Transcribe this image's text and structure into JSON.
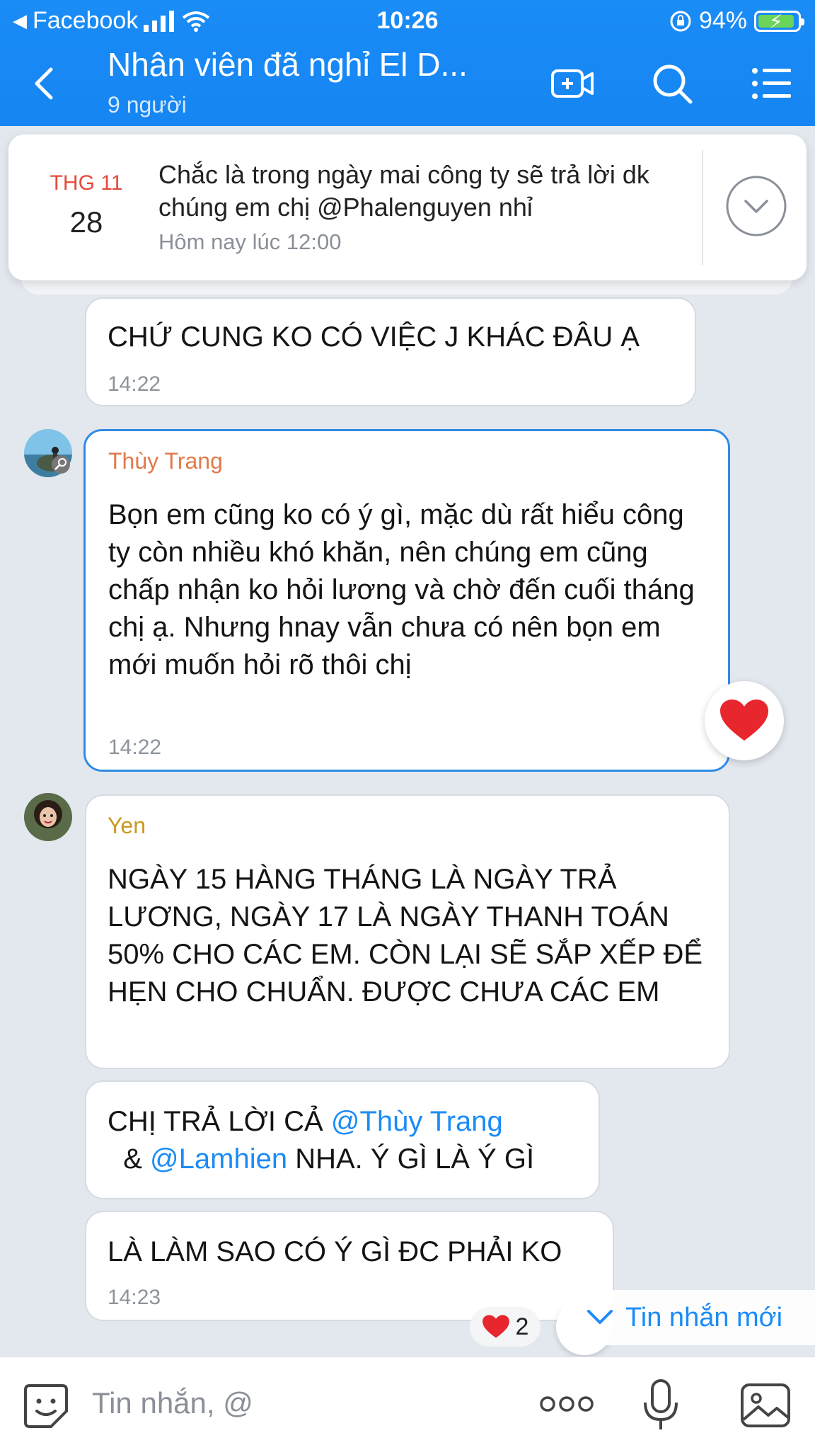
{
  "status_bar": {
    "back_app": "Facebook",
    "time": "10:26",
    "battery": "94%"
  },
  "header": {
    "title": "Nhân viên đã nghỉ El D...",
    "subtitle": "9 người"
  },
  "pinned": {
    "month": "THG 11",
    "day": "28",
    "text": "Chắc là trong ngày mai công ty sẽ trả lời dk chúng em chị @Phalenguyen nhỉ",
    "time": "Hôm nay lúc 12:00"
  },
  "messages": [
    {
      "text": "CHỨ CUNG KO CÓ VIỆC J KHÁC ĐÂU Ạ",
      "time": "14:22"
    },
    {
      "sender": "Thùy Trang",
      "sender_color": "#e07a4a",
      "text": "Bọn em cũng ko có ý gì, mặc dù rất hiểu công ty còn nhiều khó khăn, nên chúng em cũng chấp nhận ko hỏi lương và chờ đến cuối tháng chị ạ. Nhưng hnay vẫn chưa có nên bọn em mới muốn hỏi rõ thôi chị",
      "time": "14:22"
    },
    {
      "sender": "Yen",
      "sender_color": "#c99a1e",
      "text": "NGÀY 15 HÀNG THÁNG LÀ NGÀY TRẢ LƯƠNG, NGÀY 17 LÀ NGÀY THANH TOÁN 50% CHO CÁC EM. CÒN LẠI SẼ SẮP XẾP ĐỂ HẸN CHO CHUẨN. ĐƯỢC CHƯA CÁC EM"
    },
    {
      "text_pre": "CHỊ TRẢ LỜI CẢ ",
      "mention1": "@Thùy Trang",
      "text_mid": "  & ",
      "mention2": "@Lamhien",
      "text_post": " NHA. Ý GÌ LÀ Ý GÌ"
    },
    {
      "text": "LÀ LÀM SAO CÓ Ý GÌ ĐC PHẢI KO",
      "time": "14:23"
    }
  ],
  "reaction_count": "2",
  "new_messages_label": "Tin nhắn mới",
  "composer": {
    "placeholder": "Tin nhắn, @"
  },
  "colors": {
    "header_blue": "#1585f2",
    "mention_blue": "#1a8cf6",
    "highlight_border": "#2f8ce6",
    "heart_red": "#e8262d"
  }
}
